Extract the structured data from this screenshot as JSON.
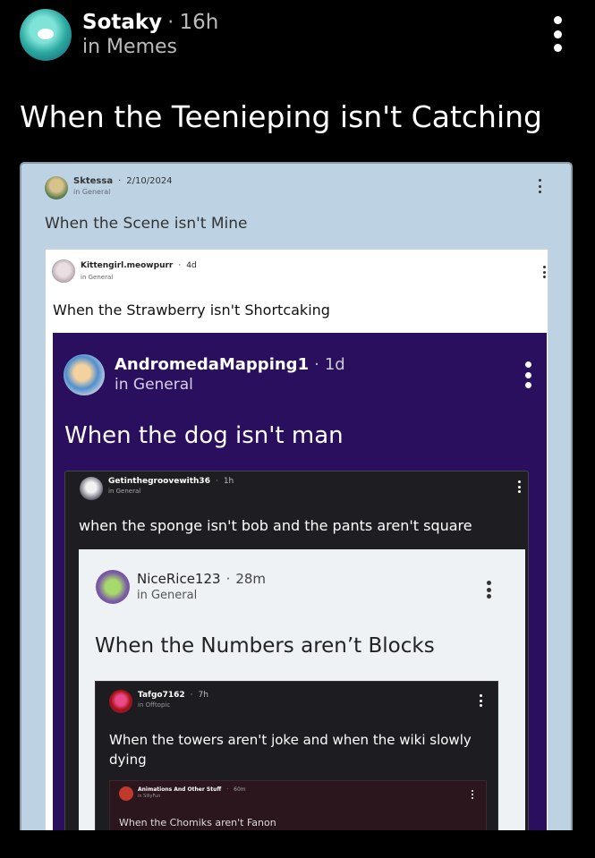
{
  "post": {
    "author": "Sotaky",
    "time": "16h",
    "community": "in Memes",
    "title": "When the Teenieping isn't Catching"
  },
  "nested": [
    {
      "author": "Sktessa",
      "time": "2/10/2024",
      "community": "in General",
      "title": "When the Scene isn't Mine"
    },
    {
      "author": "Kittengirl.meowpurr",
      "time": "4d",
      "community": "in General",
      "title": "When the Strawberry isn't Shortcaking"
    },
    {
      "author": "AndromedaMapping1",
      "time": "1d",
      "community": "in General",
      "title": "When the dog isn't man"
    },
    {
      "author": "Getinthegroovewith36",
      "time": "1h",
      "community": "in General",
      "title": "when the sponge isn't bob and the pants aren't square"
    },
    {
      "author": "NiceRice123",
      "time": "28m",
      "community": "in General",
      "title": "When the Numbers aren’t Blocks"
    },
    {
      "author": "Tafgo7162",
      "time": "7h",
      "community": "in Offtopic",
      "title": "When the towers aren't joke and when the wiki slowly dying"
    },
    {
      "author": "Animations And Other Stuff",
      "time": "60m",
      "community": "in SillyFun",
      "title": "When the Chomiks aren't Fanon"
    }
  ],
  "separator": "·",
  "icons": [
    "more-vertical-icon",
    "avatar"
  ],
  "colors": {
    "background": "#000000",
    "card_light_blue": "#bdd3e3",
    "card_white": "#ffffff",
    "card_purple": "#2a0f5e",
    "card_dark": "#1e1e22",
    "card_light": "#eef2f5",
    "card_dark2": "#1d1d21",
    "card_maroon": "#2a161c"
  }
}
